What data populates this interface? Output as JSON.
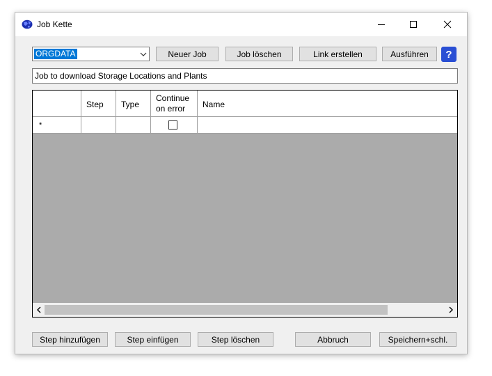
{
  "window": {
    "title": "Job Kette"
  },
  "toolbar": {
    "job_select_value": "ORGDATA",
    "new_job": "Neuer Job",
    "delete_job": "Job löschen",
    "create_link": "Link erstellen",
    "execute": "Ausführen",
    "help": "?"
  },
  "description": "Job to download Storage Locations and Plants",
  "grid": {
    "columns": {
      "step": "Step",
      "type": "Type",
      "continue_line1": "Continue",
      "continue_line2": "on error",
      "name": "Name"
    },
    "new_row_marker": "*",
    "new_row_continue_checked": false
  },
  "footer": {
    "add_step": "Step hinzufügen",
    "insert_step": "Step einfügen",
    "delete_step": "Step löschen",
    "cancel": "Abbruch",
    "save_close": "Speichern+schl."
  },
  "icons": {
    "app": "globe-app-icon",
    "minimize": "minimize-icon",
    "maximize": "maximize-icon",
    "close": "close-icon",
    "dropdown": "chevron-down-icon",
    "scroll_left": "chevron-left-icon",
    "scroll_right": "chevron-right-icon"
  },
  "colors": {
    "selection": "#0078d7",
    "help_button": "#2a4fd4",
    "grid_empty_area": "#ababab"
  }
}
